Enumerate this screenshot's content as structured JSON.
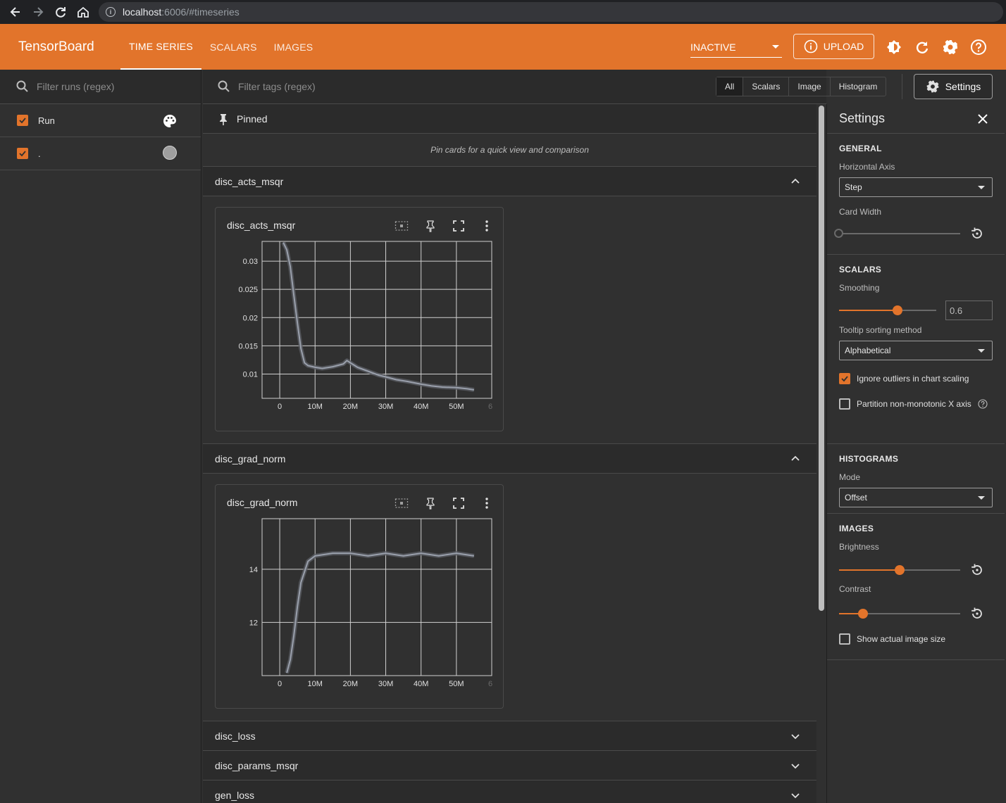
{
  "browser": {
    "url_host": "localhost",
    "url_rest": ":6006/#timeseries"
  },
  "header": {
    "brand": "TensorBoard",
    "tabs": [
      "TIME SERIES",
      "SCALARS",
      "IMAGES"
    ],
    "inactive_label": "INACTIVE",
    "upload_label": "UPLOAD"
  },
  "sidebar": {
    "filter_placeholder": "Filter runs (regex)",
    "runs": [
      {
        "label": "Run",
        "checked": true
      },
      {
        "label": ".",
        "checked": true,
        "color": "#9e9e9e"
      }
    ]
  },
  "toolbar": {
    "filter_placeholder": "Filter tags (regex)",
    "types": [
      "All",
      "Scalars",
      "Image",
      "Histogram"
    ],
    "settings_label": "Settings"
  },
  "pinned": {
    "title": "Pinned",
    "empty": "Pin cards for a quick view and comparison"
  },
  "groups": [
    {
      "name": "disc_acts_msqr",
      "expanded": true
    },
    {
      "name": "disc_grad_norm",
      "expanded": true
    },
    {
      "name": "disc_loss",
      "expanded": false
    },
    {
      "name": "disc_params_msqr",
      "expanded": false
    },
    {
      "name": "gen_loss",
      "expanded": false
    }
  ],
  "chart_data": [
    {
      "type": "line",
      "title": "disc_acts_msqr",
      "x_ticks": [
        "0",
        "10M",
        "20M",
        "30M",
        "40M",
        "50M",
        "6"
      ],
      "y_ticks": [
        "0.03",
        "0.025",
        "0.02",
        "0.015",
        "0.01"
      ],
      "xlim": [
        -5000000,
        60000000
      ],
      "ylim": [
        0.0057,
        0.0335
      ],
      "series": [
        {
          "x": [
            1000000,
            2000000,
            3000000,
            4000000,
            5000000,
            6000000,
            7000000,
            8000000,
            10000000,
            12000000,
            15000000,
            18000000,
            19000000,
            20000000,
            22000000,
            25000000,
            28000000,
            30000000,
            33000000,
            36000000,
            40000000,
            43000000,
            46000000,
            50000000,
            53000000,
            55000000
          ],
          "y": [
            0.0333,
            0.032,
            0.029,
            0.024,
            0.019,
            0.0145,
            0.012,
            0.0115,
            0.0112,
            0.011,
            0.0113,
            0.0118,
            0.0124,
            0.012,
            0.0112,
            0.0105,
            0.0098,
            0.0095,
            0.009,
            0.0087,
            0.0082,
            0.0079,
            0.0077,
            0.0076,
            0.0074,
            0.0072
          ]
        }
      ]
    },
    {
      "type": "line",
      "title": "disc_grad_norm",
      "x_ticks": [
        "0",
        "10M",
        "20M",
        "30M",
        "40M",
        "50M",
        "6"
      ],
      "y_ticks": [
        "14",
        "12"
      ],
      "xlim": [
        -5000000,
        60000000
      ],
      "ylim": [
        10,
        15.9
      ],
      "series": [
        {
          "x": [
            2000000,
            3000000,
            4000000,
            5000000,
            6000000,
            8000000,
            10000000,
            15000000,
            20000000,
            25000000,
            30000000,
            35000000,
            40000000,
            45000000,
            50000000,
            55000000
          ],
          "y": [
            10.1,
            10.6,
            11.5,
            12.6,
            13.5,
            14.3,
            14.5,
            14.6,
            14.6,
            14.5,
            14.6,
            14.5,
            14.6,
            14.5,
            14.6,
            14.5
          ]
        }
      ]
    }
  ],
  "settings": {
    "title": "Settings",
    "general": {
      "head": "GENERAL",
      "horizontal_axis_label": "Horizontal Axis",
      "horizontal_axis_value": "Step",
      "card_width_label": "Card Width",
      "card_width": 0
    },
    "scalars": {
      "head": "SCALARS",
      "smoothing_label": "Smoothing",
      "smoothing": 0.6,
      "smoothing_text": "0.6",
      "tooltip_label": "Tooltip sorting method",
      "tooltip_value": "Alphabetical",
      "ignore_outliers_label": "Ignore outliers in chart scaling",
      "ignore_outliers": true,
      "partition_label": "Partition non-monotonic X axis",
      "partition": false
    },
    "histograms": {
      "head": "HISTOGRAMS",
      "mode_label": "Mode",
      "mode_value": "Offset"
    },
    "images": {
      "head": "IMAGES",
      "brightness_label": "Brightness",
      "brightness": 0.5,
      "contrast_label": "Contrast",
      "contrast": 0.2,
      "actual_size_label": "Show actual image size",
      "actual_size": false
    }
  },
  "colors": {
    "accent": "#e2742b",
    "series": "#9aa0ac"
  }
}
